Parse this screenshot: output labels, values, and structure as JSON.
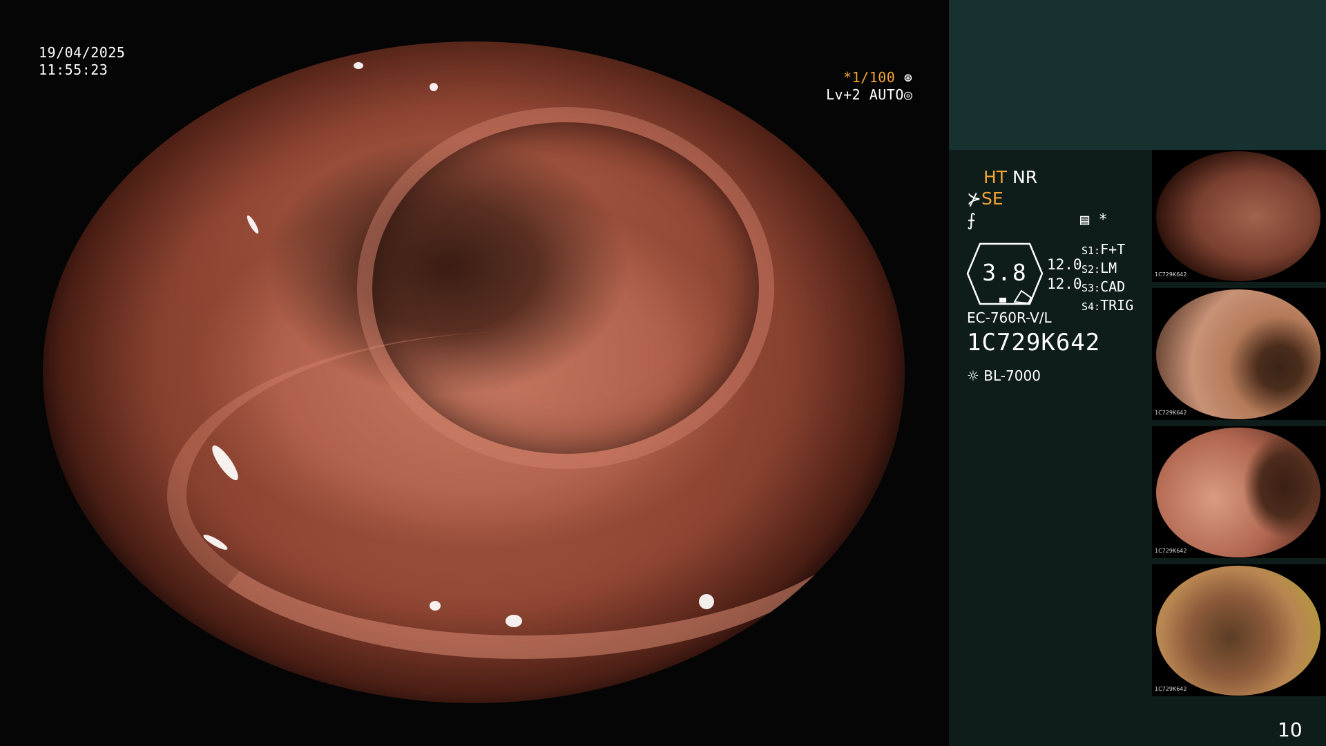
{
  "timestamp": {
    "date": "19/04/2025",
    "time": "11:55:23"
  },
  "zoom": {
    "shutter": "*1/100",
    "shutter_icon": "aperture-icon",
    "level": "Lv+2",
    "mode": "AUTO",
    "mode_icon": "ring-icon"
  },
  "panel": {
    "modes": {
      "ht": "HT",
      "nr": "NR",
      "se": "SE",
      "f_icon": "f-icon",
      "se_icon": "scope-icon"
    },
    "extra_icons": {
      "menu": "menu-icon",
      "star": "*"
    },
    "hex_value": "3.8",
    "ratios": [
      "12.0",
      "12.0"
    ],
    "slots": [
      {
        "key": "S1:",
        "value": "F+T"
      },
      {
        "key": "S2:",
        "value": "LM"
      },
      {
        "key": "S3:",
        "value": "CAD"
      },
      {
        "key": "S4:",
        "value": "TRIG"
      }
    ],
    "scope_model": "EC-760R-V/L",
    "serial": "1C729K642",
    "light_source": "BL-7000",
    "light_icon": "sun-icon"
  },
  "thumbnails": [
    {
      "label": "1C729K642"
    },
    {
      "label": "1C729K642"
    },
    {
      "label": "1C729K642"
    },
    {
      "label": "1C729K642"
    }
  ],
  "page_number": "10",
  "colors": {
    "panel_top": "#163130",
    "panel_bottom": "#0e1c1a",
    "accent": "#f2a534"
  }
}
